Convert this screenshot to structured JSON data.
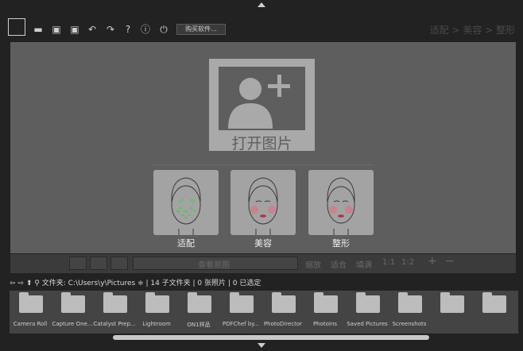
{
  "toolbar": {
    "buy_label": "购买软件...",
    "breadcrumb": "适配 > 美容 > 整形",
    "help": "?",
    "info": "ⓘ"
  },
  "main": {
    "open_label": "打开图片",
    "thumbnails": [
      {
        "label": "适配",
        "icon": "face-fit-icon"
      },
      {
        "label": "美容",
        "icon": "face-beauty-icon"
      },
      {
        "label": "整形",
        "icon": "face-shape-icon"
      }
    ]
  },
  "strip": {
    "view_original": "查看原图",
    "zoom": "缩放",
    "fit": "适合",
    "fill": "填满",
    "ratio1": "1:1",
    "ratio2": "1:2",
    "plus": "+",
    "minus": "−"
  },
  "pathbar": {
    "text": "文件夹: C:\\Users\\y\\Pictures ≑ | 14 子文件夹 | 0 张照片 | 0 已选定"
  },
  "folders": [
    "Camera Roll",
    "Capture One...",
    "Catalyst Prep...",
    "Lightroom",
    "ON1样品",
    "PDFChef by...",
    "PhotoDirector",
    "PhotoIns",
    "Saved Pictures",
    "Screenshots",
    "",
    ""
  ]
}
